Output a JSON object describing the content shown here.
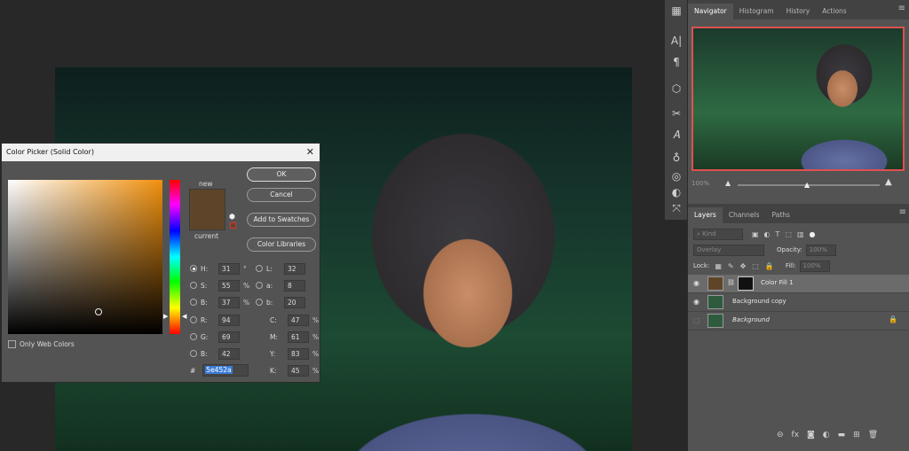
{
  "navigator": {
    "tabs": [
      "Navigator",
      "Histogram",
      "History",
      "Actions"
    ],
    "zoom": "100%"
  },
  "layers_panel": {
    "tabs": [
      "Layers",
      "Channels",
      "Paths"
    ],
    "kind_placeholder": "Kind",
    "blend_mode": "Overlay",
    "opacity_label": "Opacity:",
    "opacity_value": "100%",
    "lock_label": "Lock:",
    "fill_label": "Fill:",
    "fill_value": "100%",
    "layers": [
      {
        "name": "Color Fill 1",
        "selected": true
      },
      {
        "name": "Background copy",
        "selected": false
      },
      {
        "name": "Background",
        "selected": false
      }
    ]
  },
  "color_picker": {
    "title": "Color Picker (Solid Color)",
    "close": "✕",
    "new_label": "new",
    "current_label": "current",
    "swatch_color": "#5e452a",
    "buttons": {
      "ok": "OK",
      "cancel": "Cancel",
      "add_to_swatches": "Add to Swatches",
      "color_libraries": "Color Libraries"
    },
    "only_web_colors": "Only Web Colors",
    "hsb": {
      "h_label": "H:",
      "h": "31",
      "h_unit": "°",
      "s_label": "S:",
      "s": "55",
      "s_unit": "%",
      "b_label": "B:",
      "b": "37",
      "b_unit": "%"
    },
    "lab": {
      "l_label": "L:",
      "l": "32",
      "a_label": "a:",
      "a": "8",
      "b_label": "b:",
      "b": "20"
    },
    "rgb": {
      "r_label": "R:",
      "r": "94",
      "g_label": "G:",
      "g": "69",
      "b_label": "B:",
      "b": "42"
    },
    "cmyk": {
      "c_label": "C:",
      "c": "47",
      "m_label": "M:",
      "m": "61",
      "y_label": "Y:",
      "y": "83",
      "k_label": "K:",
      "k": "45",
      "unit": "%"
    },
    "hex_label": "#",
    "hex": "5e452a"
  }
}
